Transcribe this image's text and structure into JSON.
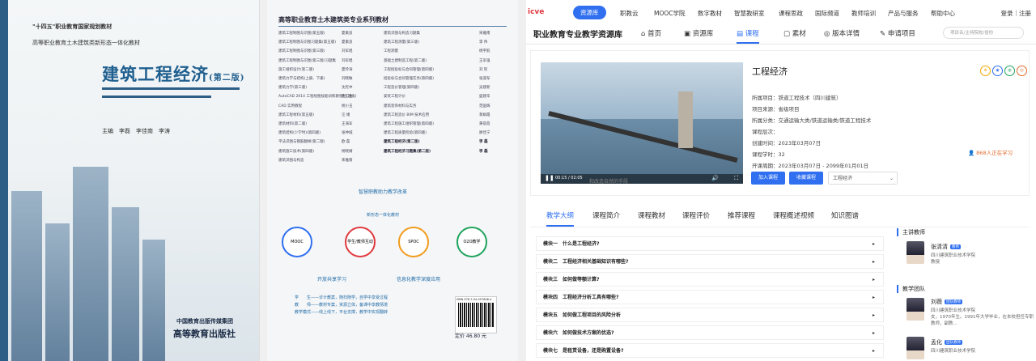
{
  "front_cover": {
    "badge_line": "\"十四五\"职业教育国家规划教材",
    "series_line": "高等职业教育土木建筑类新形态一体化教材",
    "title": "建筑工程经济",
    "edition": "(第二版)",
    "authors": "主编　李磊　李佳南　李涛",
    "publisher": "中国教育出版传媒集团",
    "publisher_seal": "高等教育出版社"
  },
  "back_cover": {
    "series_title": "高等职业教育土木建筑类专业系列教材",
    "books": [
      [
        "建筑工程制图与识图(第五版)",
        "夏素良",
        "建筑识图与构造习题集",
        "宋雅南"
      ],
      [
        "建筑工程制图与识图习题集(第五版)",
        "夏素良",
        "建筑工程测量(第三版)",
        "李 伟"
      ],
      [
        "建筑工程制图与识图(第三版)",
        "刘军旭",
        "工程测量",
        "杨宇航"
      ],
      [
        "建筑工程制图与识图(第三版)习题集",
        "刘军旭",
        "基础土建制造工程(第二版)",
        "王军强"
      ],
      [
        "施工组织设计(第二版)",
        "夏玲涛",
        "工程招投标与合同管理(第四版)",
        "刘 钦"
      ],
      [
        "建筑力学与结构(上册、下册)",
        "刘晓敏",
        "招投标与合同管理实务(第四版)",
        "张道军"
      ],
      [
        "建筑力学(第三版)",
        "沈宪中",
        "工程造价管理(第四版)",
        "吴建新"
      ],
      [
        "AutoCAD 2014 工程绘图技能训练教程(土建类)",
        "曹仁金",
        "安装工程计价",
        "盛建华"
      ],
      [
        "CAD 实用教程",
        "杨小玉",
        "建筑装饰材料与实务",
        "范国辉"
      ],
      [
        "建筑工程材料(第五版)",
        "汪 绪",
        "建筑工程造价 BIM 技术应用",
        "蒋娟霞"
      ],
      [
        "建筑材料(第二版)",
        "王海军",
        "建筑工程施工组织管理(第四版)",
        "黄蓓蓓"
      ],
      [
        "建筑结构(少学时)(第四版)",
        "张仲城",
        "建筑工程质量检验(第四版)",
        "廖佳宁"
      ],
      [
        "平法识图与钢筋翻样(第二版)",
        "欧 磊",
        "建筑工程经济(第二版)",
        "李 磊"
      ],
      [
        "建筑施工技术(第四版)",
        "杨晓婧",
        "建筑工程经济习题集(第二版)",
        "李 磊"
      ],
      [
        "建筑识图与构造",
        "宋雅南",
        "",
        ""
      ]
    ],
    "circle_title": "智慧职教助力教学改革",
    "circle_sub": "新形态一体化教材",
    "modules": [
      "MOOC",
      "学生/教师互动",
      "SPOC",
      "O2O教学"
    ],
    "arrow_left": "开放共享学习",
    "arrow_right": "信息化教学深度应用",
    "notes": [
      "学　　生——诊计教案，随扫随学，自学中享受过程",
      "教　　师——教材专案，资源立体，备课中享教情境",
      "教学模式——线上线下，平台支撑，教学中实现翻转"
    ],
    "isbn": "ISBN 978-7-04-057808-4",
    "price": "定价 46.80 元"
  },
  "web": {
    "logo": "icve",
    "nav_items": [
      "资源库",
      "职教云",
      "MOOC学院",
      "数字教材",
      "智慧教研室",
      "课程思政",
      "国际频道",
      "教师培训",
      "产品与服务",
      "帮助中心"
    ],
    "login": "登录｜注册",
    "brand": "职业教育专业教学资源库",
    "sub_tabs": [
      "首页",
      "资源库",
      "课程",
      "素材",
      "版本详情",
      "申请项目"
    ],
    "search_placeholder": "项目名/主持院校/省份",
    "course_title": "工程经济",
    "video_caption": "和改造自然的手段",
    "video_time": "00:15 / 02:05",
    "meta": [
      "所属项目：铁道工程技术（四川建筑）",
      "项目来源：省级项目",
      "所属分类：交通运输大类/铁道运输类/铁道工程技术",
      "课程层次：",
      "创建时间：2023年03月07日",
      "课程学时：32",
      "开课周期：2023年03月07日 - 2099年01月01日"
    ],
    "learners": "868人正在学习",
    "btn_join": "加入课程",
    "btn_collect": "收藏课程",
    "btn_select": "工程经济",
    "content_tabs": [
      "教学大纲",
      "课程简介",
      "课程教材",
      "课程评价",
      "推荐课程",
      "课程概述视频",
      "知识图谱"
    ],
    "modules": [
      "模块一　什么是工程经济?",
      "模块二　工程经济相关基础知识有哪些?",
      "模块三　如何做等额计算?",
      "模块四　工程经济分析工具有哪些?",
      "模块五　如何做工程项目的风险分析",
      "模块六　如何做技术方案的优选?",
      "模块七　是租赁设备，还是购置设备?"
    ],
    "main_teacher_label": "主讲教师",
    "team_label": "教学团队",
    "teachers": [
      {
        "name": "张清清",
        "badge": "教师",
        "org": "四川建筑职业技术学院",
        "title": "教授"
      },
      {
        "name": "刘薇",
        "badge": "团队教师",
        "org": "四川建筑职业技术学院",
        "title": "女，1970年生。1991年大学毕业，在本校担任专职教师，副教..."
      },
      {
        "name": "孟化",
        "badge": "团队教师",
        "org": "四川建筑职业技术学院",
        "title": ""
      }
    ]
  }
}
